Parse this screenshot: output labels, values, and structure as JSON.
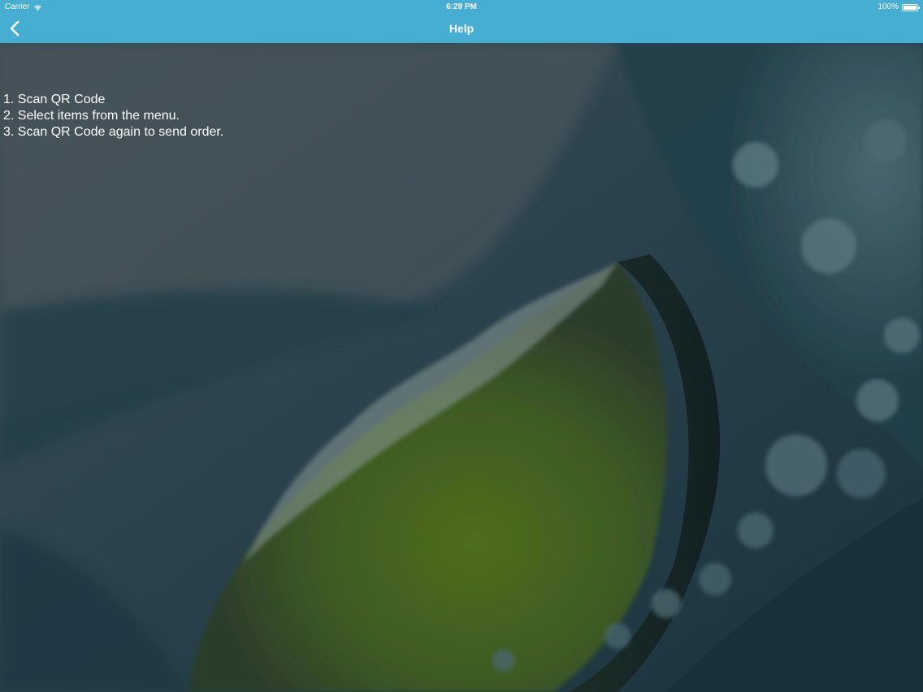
{
  "status_bar": {
    "carrier": "Carrier",
    "time": "6:29 PM",
    "battery": "100%",
    "battery_level": 1.0
  },
  "nav": {
    "title": "Help",
    "back_icon": "chevron-left-icon"
  },
  "help": {
    "steps": [
      "1. Scan QR Code",
      "2. Select items from the menu.",
      "3. Scan QR Code again to send order."
    ]
  },
  "colors": {
    "header": "#46aed3",
    "text": "#ffffff"
  }
}
